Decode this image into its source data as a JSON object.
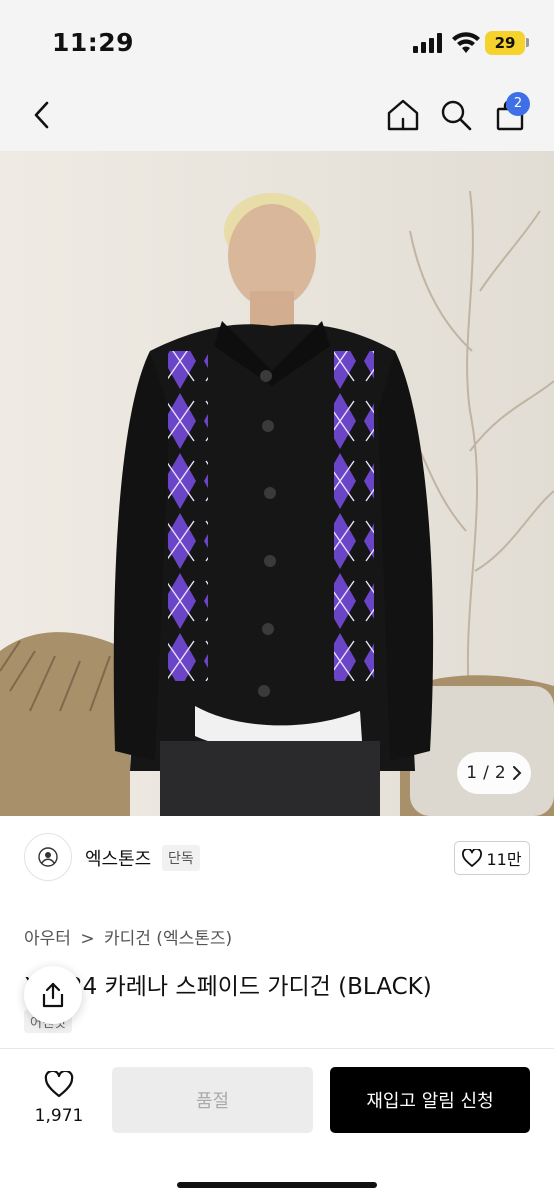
{
  "status": {
    "time": "11:29",
    "battery": "29"
  },
  "nav": {
    "cart_count": "2"
  },
  "gallery": {
    "current": "1",
    "separator": "/",
    "total": "2"
  },
  "brand": {
    "name": "엑스톤즈",
    "tag": "단독",
    "likes": "11만"
  },
  "breadcrumb": {
    "level1": "아우터",
    "separator": ">",
    "level2": "카디건 (엑스톤즈)"
  },
  "product": {
    "title": "XT024 카레나 스페이드 가디건 (BLACK)",
    "tag": "어텐핏"
  },
  "bottom_bar": {
    "wish_count": "1,971",
    "soldout_label": "품절",
    "restock_label": "재입고 알림 신청"
  },
  "colors": {
    "accent_blue": "#3f6fe6",
    "battery_yellow": "#f6d22c",
    "argyle_purple": "#6b45c7"
  },
  "icons": [
    "back-icon",
    "home-icon",
    "search-icon",
    "cart-icon",
    "heart-icon",
    "share-icon",
    "chevron-right-icon"
  ]
}
